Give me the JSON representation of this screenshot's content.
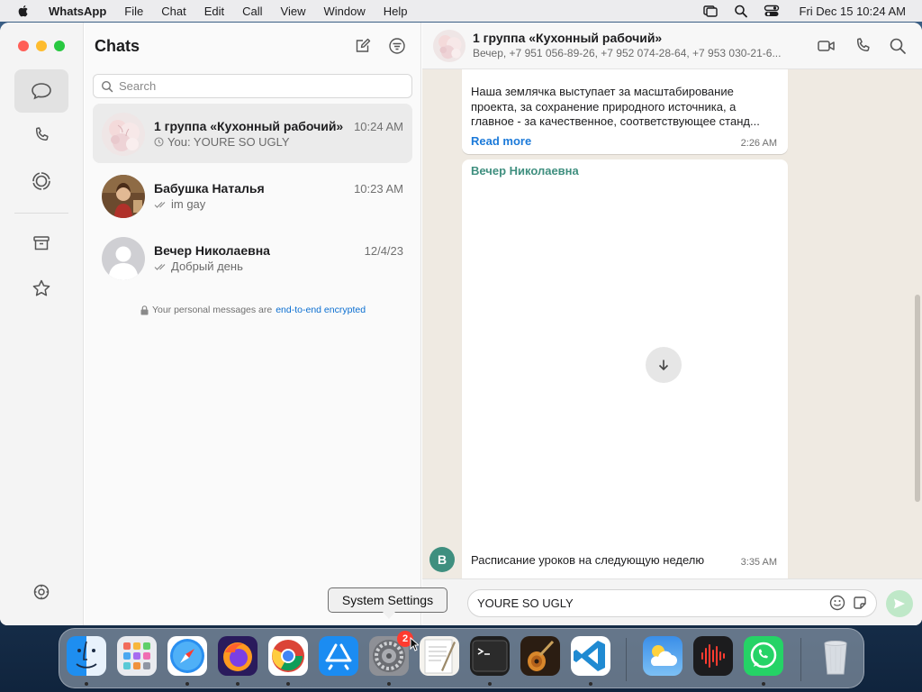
{
  "menubar": {
    "app_name": "WhatsApp",
    "menus": [
      "File",
      "Chat",
      "Edit",
      "Call",
      "View",
      "Window",
      "Help"
    ],
    "clock": "Fri Dec 15  10:24 AM"
  },
  "chat_list": {
    "title": "Chats",
    "search_placeholder": "Search",
    "chats": [
      {
        "name": "1 группа «Кухонный рабочий»",
        "time": "10:24 AM",
        "preview": "You: YOURE SO UGLY",
        "status": "clock-icon"
      },
      {
        "name": "Бабушка Наталья",
        "time": "10:23 AM",
        "preview": "im gay",
        "status": "double-check-icon"
      },
      {
        "name": "Вечер Николаевна",
        "time": "12/4/23",
        "preview": "Добрый день",
        "status": "double-check-icon"
      }
    ],
    "encryption_text": "Your personal messages are",
    "encryption_link": "end-to-end encrypted"
  },
  "conversation": {
    "title": "1 группа «Кухонный рабочий»",
    "subtitle": "Вечер, +7 951 056-89-26, +7 952 074-28-64, +7 953 030-21-6...",
    "messages": [
      {
        "lines": [
          "Наша землячка выступает за масштабирование",
          "проекта, за сохранение природного источника, а",
          "главное - за качественное, соответствующее станд..."
        ],
        "read_more": "Read more",
        "time": "2:26 AM"
      },
      {
        "sender": "Вечер Николаевна",
        "sender_initial": "В",
        "text": "Расписание уроков на следующую неделю",
        "time": "3:35 AM"
      }
    ],
    "composer_value": "YOURE SO UGLY"
  },
  "tooltip": "System Settings",
  "dock": {
    "apps": [
      "Finder",
      "Launchpad",
      "Safari",
      "Firefox",
      "Chrome",
      "App Store",
      "System Settings",
      "TextEdit",
      "Terminal",
      "GarageBand",
      "Visual Studio Code",
      "Weather",
      "Voice Memos",
      "WhatsApp",
      "Trash"
    ],
    "system_settings_badge": "2"
  },
  "colors": {
    "accent_green": "#25d366",
    "sender_teal": "#3f8f7f",
    "link_blue": "#1c7ad9",
    "chat_bg": "#efeae2"
  }
}
